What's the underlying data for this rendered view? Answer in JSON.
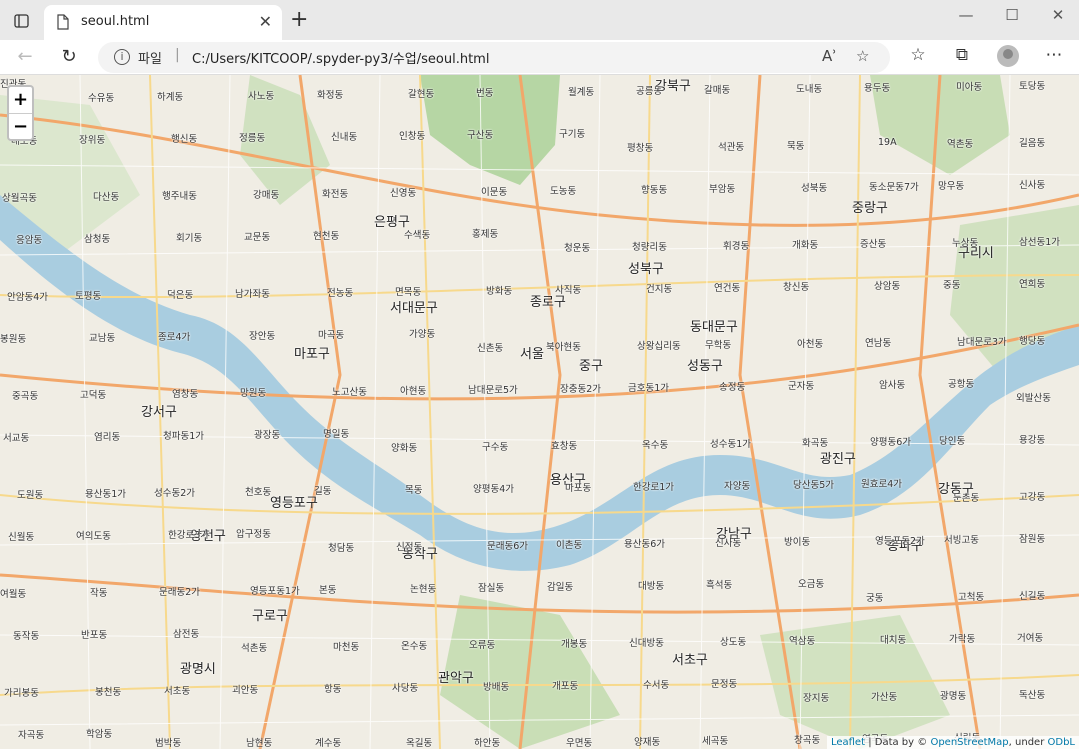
{
  "browser": {
    "tab_title": "seoul.html",
    "address_scheme": "파일",
    "address_url": "C:/Users/KITCOOP/.spyder-py3/수업/seoul.html"
  },
  "map": {
    "zoom_in": "+",
    "zoom_out": "−",
    "attribution": {
      "leaflet": "Leaflet",
      "data_by": "| Data by ©",
      "osm": "OpenStreetMap",
      "under": ", under",
      "odbl": "ODbL"
    },
    "district_labels": [
      "강북구",
      "은평구",
      "종로구",
      "서대문구",
      "마포구",
      "서울",
      "중구",
      "동대문구",
      "성북구",
      "중랑구",
      "구리시",
      "성동구",
      "강서구",
      "용산구",
      "광진구",
      "영등포구",
      "양천구",
      "강동구",
      "강남구",
      "동작구",
      "송파구",
      "구로구",
      "광명시",
      "관악구",
      "서초구"
    ],
    "area_labels": [
      "진관동",
      "수유동",
      "하계동",
      "사노동",
      "화정동",
      "갈현동",
      "번동",
      "월계동",
      "공릉동",
      "갈매동",
      "도내동",
      "용두동",
      "미아동",
      "토당동",
      "대조동",
      "장위동",
      "행신동",
      "정릉동",
      "신내동",
      "인창동",
      "구산동",
      "구기동",
      "평창동",
      "석관동",
      "묵동",
      "19A",
      "역촌동",
      "길음동",
      "상월곡동",
      "다산동",
      "행주내동",
      "강매동",
      "화전동",
      "신영동",
      "이문동",
      "도농동",
      "향동동",
      "부암동",
      "성북동",
      "동소문동7가",
      "망우동",
      "신사동",
      "응암동",
      "삼청동",
      "회기동",
      "교문동",
      "현천동",
      "수색동",
      "홍제동",
      "청운동",
      "청량리동",
      "휘경동",
      "개화동",
      "증산동",
      "누상동",
      "삼선동1가",
      "안암동4가",
      "토평동",
      "덕은동",
      "남가좌동",
      "전농동",
      "면목동",
      "방화동",
      "사직동",
      "건지동",
      "연건동",
      "창신동",
      "상암동",
      "중동",
      "연희동",
      "봉원동",
      "교남동",
      "종로4가",
      "장안동",
      "마곡동",
      "가양동",
      "신촌동",
      "북아현동",
      "상왕십리동",
      "무학동",
      "아천동",
      "연남동",
      "남대문로3가",
      "행당동",
      "중곡동",
      "고덕동",
      "염창동",
      "망원동",
      "노고산동",
      "아현동",
      "남대문로5가",
      "장충동2가",
      "금호동1가",
      "송정동",
      "군자동",
      "암사동",
      "공항동",
      "외발산동",
      "서교동",
      "염리동",
      "청파동1가",
      "광장동",
      "명일동",
      "양화동",
      "구수동",
      "효창동",
      "옥수동",
      "성수동1가",
      "화곡동",
      "양평동6가",
      "당인동",
      "용강동",
      "도원동",
      "용산동1가",
      "성수동2가",
      "천호동",
      "길동",
      "목동",
      "양평동4가",
      "마포동",
      "한강로1가",
      "자양동",
      "당산동5가",
      "원효로4가",
      "둔촌동",
      "고강동",
      "신월동",
      "여의도동",
      "한강로3가",
      "압구정동",
      "청담동",
      "신정동",
      "문래동6가",
      "이촌동",
      "용산동6가",
      "신사동",
      "방이동",
      "영등포동2가",
      "서빙고동",
      "잠원동",
      "여월동",
      "작동",
      "문래동2가",
      "영등포동1가",
      "본동",
      "논현동",
      "잠실동",
      "감일동",
      "대방동",
      "흑석동",
      "오금동",
      "궁동",
      "고척동",
      "신길동",
      "동작동",
      "반포동",
      "삼전동",
      "석촌동",
      "마천동",
      "온수동",
      "오류동",
      "개봉동",
      "신대방동",
      "상도동",
      "역삼동",
      "대치동",
      "가락동",
      "거여동",
      "가리봉동",
      "봉천동",
      "서초동",
      "괴안동",
      "항동",
      "사당동",
      "방배동",
      "개포동",
      "수서동",
      "문정동",
      "장지동",
      "가산동",
      "광명동",
      "독산동",
      "자곡동",
      "학암동",
      "범박동",
      "남현동",
      "계수동",
      "옥길동",
      "하안동",
      "우면동",
      "양재동",
      "세곡동",
      "창곡동",
      "염곡동",
      "신림동"
    ]
  }
}
